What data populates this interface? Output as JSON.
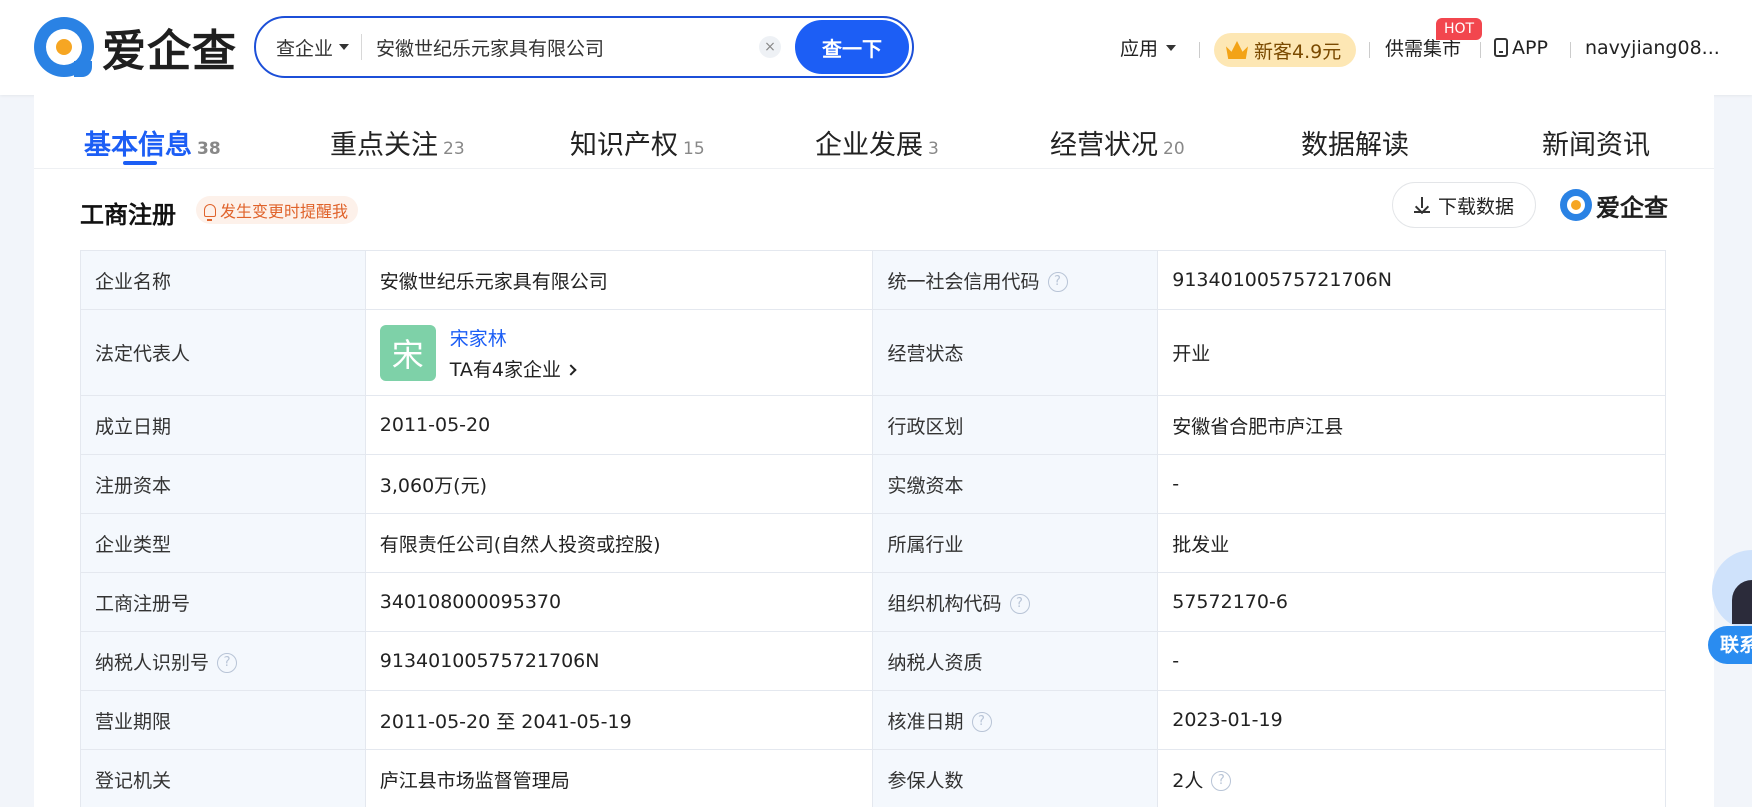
{
  "header": {
    "logo_text": "爱企查",
    "search_type": "查企业",
    "search_value": "安徽世纪乐元家具有限公司",
    "search_button": "查一下",
    "clear_label": "×",
    "app_menu": "应用",
    "promo": "新客4.9元",
    "market": "供需集市",
    "hot_badge": "HOT",
    "app_link": "APP",
    "user": "navyjiang08..."
  },
  "tabs": [
    {
      "label": "基本信息",
      "count": "38"
    },
    {
      "label": "重点关注",
      "count": "23"
    },
    {
      "label": "知识产权",
      "count": "15"
    },
    {
      "label": "企业发展",
      "count": "3"
    },
    {
      "label": "经营状况",
      "count": "20"
    },
    {
      "label": "数据解读",
      "count": ""
    },
    {
      "label": "新闻资讯",
      "count": ""
    }
  ],
  "section": {
    "title": "工商注册",
    "remind": "发生变更时提醒我",
    "download": "下载数据",
    "brand": "爱企查"
  },
  "info": {
    "company_name_label": "企业名称",
    "company_name": "安徽世纪乐元家具有限公司",
    "credit_code_label": "统一社会信用代码",
    "credit_code": "91340100575721706N",
    "legal_rep_label": "法定代表人",
    "legal_rep_avatar": "宋",
    "legal_rep_name": "宋家林",
    "legal_rep_sub": "TA有4家企业",
    "status_label": "经营状态",
    "status": "开业",
    "founded_label": "成立日期",
    "founded": "2011-05-20",
    "region_label": "行政区划",
    "region": "安徽省合肥市庐江县",
    "reg_capital_label": "注册资本",
    "reg_capital": "3,060万(元)",
    "paid_capital_label": "实缴资本",
    "paid_capital": "-",
    "type_label": "企业类型",
    "type": "有限责任公司(自然人投资或控股)",
    "industry_label": "所属行业",
    "industry": "批发业",
    "reg_no_label": "工商注册号",
    "reg_no": "340108000095370",
    "org_code_label": "组织机构代码",
    "org_code": "57572170-6",
    "taxpayer_id_label": "纳税人识别号",
    "taxpayer_id": "91340100575721706N",
    "taxpayer_qual_label": "纳税人资质",
    "taxpayer_qual": "-",
    "term_label": "营业期限",
    "term": "2011-05-20 至 2041-05-19",
    "approve_date_label": "核准日期",
    "approve_date": "2023-01-19",
    "authority_label": "登记机关",
    "authority": "庐江县市场监督管理局",
    "insured_label": "参保人数",
    "insured": "2人"
  },
  "float": {
    "contact": "联系"
  },
  "colors": {
    "primary": "#1c5ef5",
    "label_bg": "#f4f8fd",
    "hot": "#f2464e",
    "remind": "#e0632b"
  }
}
